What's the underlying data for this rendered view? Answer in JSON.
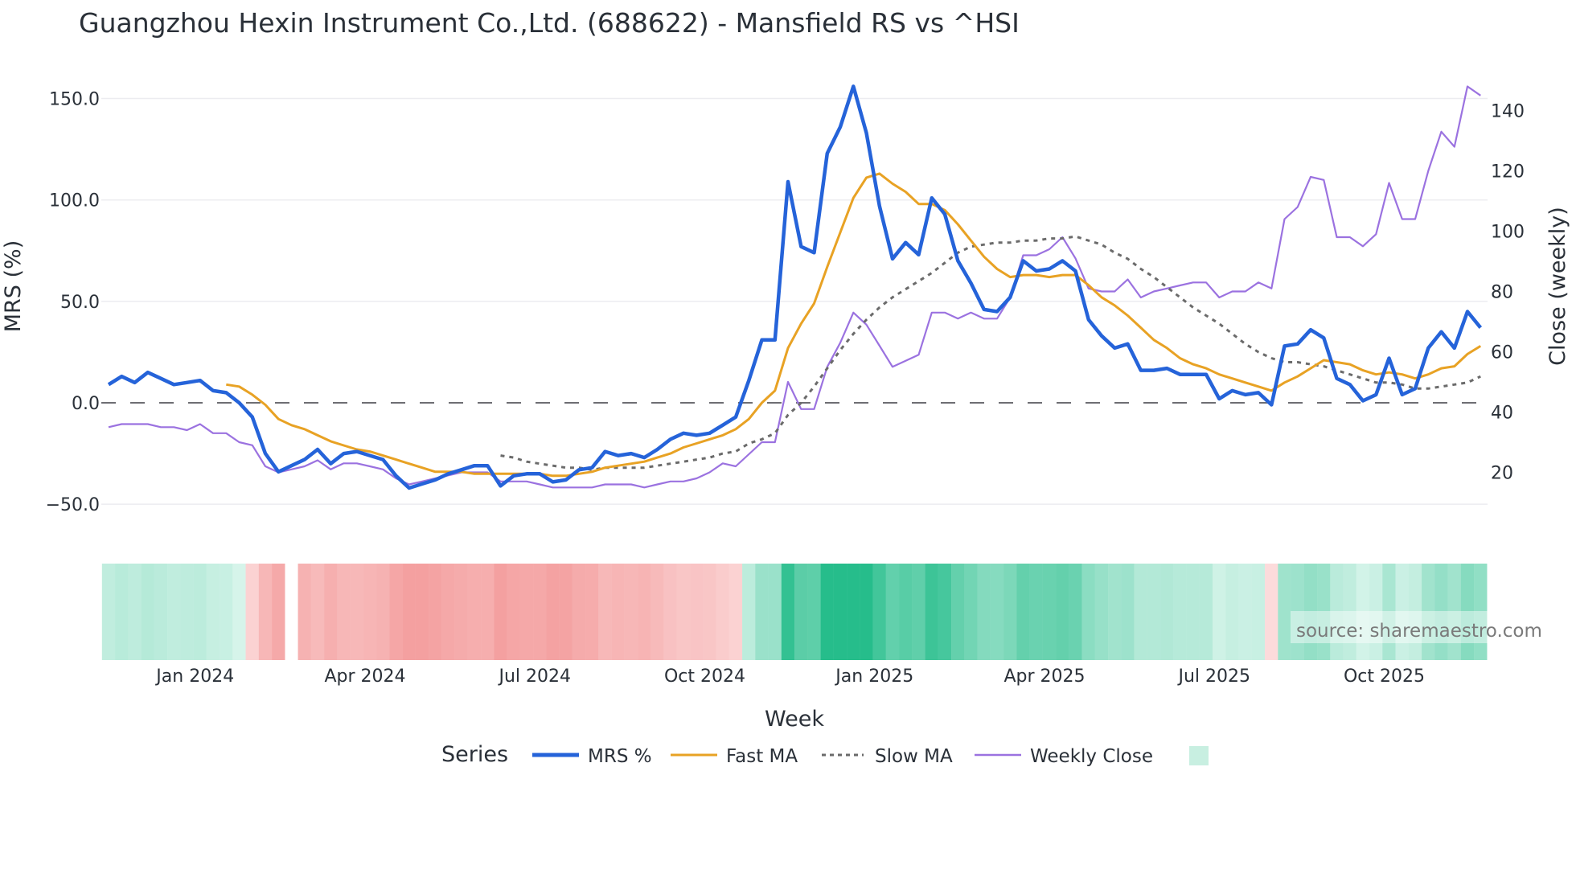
{
  "chart_data": {
    "type": "line",
    "title": "Guangzhou Hexin Instrument Co.,Ltd. (688622) - Mansfield RS vs ^HSI",
    "xlabel": "Week",
    "ylabel_left": "MRS (%)",
    "ylabel_right": "Close (weekly)",
    "x_ticks": [
      "Jan 2024",
      "Apr 2024",
      "Jul 2024",
      "Oct 2024",
      "Jan 2025",
      "Apr 2025",
      "Jul 2025",
      "Oct 2025"
    ],
    "x_tick_week_index": [
      7,
      20,
      33,
      46,
      59,
      72,
      85,
      98
    ],
    "y_left_ticks": [
      "150.0",
      "100.0",
      "50.0",
      "0.0",
      "−50.0"
    ],
    "y_left_tick_values": [
      150,
      100,
      50,
      0,
      -50
    ],
    "y_right_ticks": [
      "140",
      "120",
      "100",
      "80",
      "60",
      "40",
      "20"
    ],
    "y_right_tick_values": [
      140,
      120,
      100,
      80,
      60,
      40,
      20
    ],
    "zero_line": 0,
    "grid": true,
    "legend_title": "Series",
    "legend_position": "bottom",
    "source": "source: sharemaestro.com",
    "colors": {
      "mrs": "#2563d9",
      "fast": "#e8a224",
      "slow": "#6b6b6b",
      "close": "#9b72e0",
      "pos": "#26bd8b",
      "neg": "#f4a0a0"
    },
    "heatmap_gaps": [
      14
    ],
    "series": [
      {
        "name": "MRS %",
        "axis": "left",
        "start": 0,
        "values": [
          9,
          13,
          10,
          15,
          12,
          9,
          10,
          11,
          6,
          5,
          0,
          -7,
          -25,
          -34,
          -31,
          -28,
          -23,
          -30,
          -25,
          -24,
          -26,
          -28,
          -36,
          -42,
          -40,
          -38,
          -35,
          -33,
          -31,
          -31,
          -41,
          -36,
          -35,
          -35,
          -39,
          -38,
          -33,
          -32,
          -24,
          -26,
          -25,
          -27,
          -23,
          -18,
          -15,
          -16,
          -15,
          -11,
          -7,
          11,
          31,
          31,
          109,
          77,
          74,
          123,
          136,
          156,
          133,
          97,
          71,
          79,
          73,
          101,
          93,
          70,
          59,
          46,
          45,
          52,
          70,
          65,
          66,
          70,
          65,
          41,
          33,
          27,
          29,
          16,
          16,
          17,
          14,
          14,
          14,
          2,
          6,
          4,
          5,
          -1,
          28,
          29,
          36,
          32,
          12,
          9,
          1,
          4,
          22,
          4,
          7,
          27,
          35,
          27,
          45,
          37
        ]
      },
      {
        "name": "Fast MA",
        "axis": "left",
        "start": 9,
        "values": [
          9,
          8,
          4,
          -1,
          -8,
          -11,
          -13,
          -16,
          -19,
          -21,
          -23,
          -24,
          -26,
          -28,
          -30,
          -32,
          -34,
          -34,
          -34,
          -35,
          -35,
          -35,
          -35,
          -35,
          -35,
          -36,
          -36,
          -35,
          -34,
          -32,
          -31,
          -30,
          -29,
          -27,
          -25,
          -22,
          -20,
          -18,
          -16,
          -13,
          -8,
          0,
          6,
          27,
          39,
          49,
          67,
          84,
          101,
          111,
          113,
          108,
          104,
          98,
          98,
          95,
          88,
          80,
          72,
          66,
          62,
          63,
          63,
          62,
          63,
          63,
          58,
          52,
          48,
          43,
          37,
          31,
          27,
          22,
          19,
          17,
          14,
          12,
          10,
          8,
          6,
          10,
          13,
          17,
          21,
          20,
          19,
          16,
          14,
          15,
          14,
          12,
          14,
          17,
          18,
          24,
          28
        ]
      },
      {
        "name": "Slow MA",
        "axis": "left",
        "start": 30,
        "values": [
          -26,
          -27,
          -29,
          -30,
          -31,
          -32,
          -32,
          -33,
          -32,
          -32,
          -32,
          -32,
          -31,
          -30,
          -29,
          -28,
          -27,
          -25,
          -24,
          -20,
          -18,
          -15,
          -6,
          0,
          8,
          17,
          26,
          34,
          41,
          47,
          52,
          56,
          60,
          64,
          69,
          74,
          77,
          78,
          79,
          79,
          80,
          80,
          81,
          81,
          82,
          80,
          78,
          74,
          71,
          66,
          62,
          57,
          52,
          47,
          43,
          39,
          34,
          29,
          25,
          22,
          20,
          20,
          19,
          18,
          16,
          14,
          12,
          10,
          10,
          9,
          7,
          7,
          8,
          9,
          10,
          13
        ]
      },
      {
        "name": "Weekly Close",
        "axis": "right",
        "start": 0,
        "values": [
          35,
          36,
          36,
          36,
          35,
          35,
          34,
          36,
          33,
          33,
          30,
          29,
          22,
          20,
          21,
          22,
          24,
          21,
          23,
          23,
          22,
          21,
          18,
          16,
          17,
          18,
          19,
          20,
          20,
          20,
          17,
          17,
          17,
          16,
          15,
          15,
          15,
          15,
          16,
          16,
          16,
          15,
          16,
          17,
          17,
          18,
          20,
          23,
          22,
          26,
          30,
          30,
          50,
          41,
          41,
          55,
          63,
          73,
          69,
          62,
          55,
          57,
          59,
          73,
          73,
          71,
          73,
          71,
          71,
          78,
          92,
          92,
          94,
          98,
          91,
          81,
          80,
          80,
          84,
          78,
          80,
          81,
          82,
          83,
          83,
          78,
          80,
          80,
          83,
          81,
          104,
          108,
          118,
          117,
          98,
          98,
          95,
          99,
          116,
          104,
          104,
          120,
          133,
          128,
          148,
          145
        ]
      }
    ]
  }
}
